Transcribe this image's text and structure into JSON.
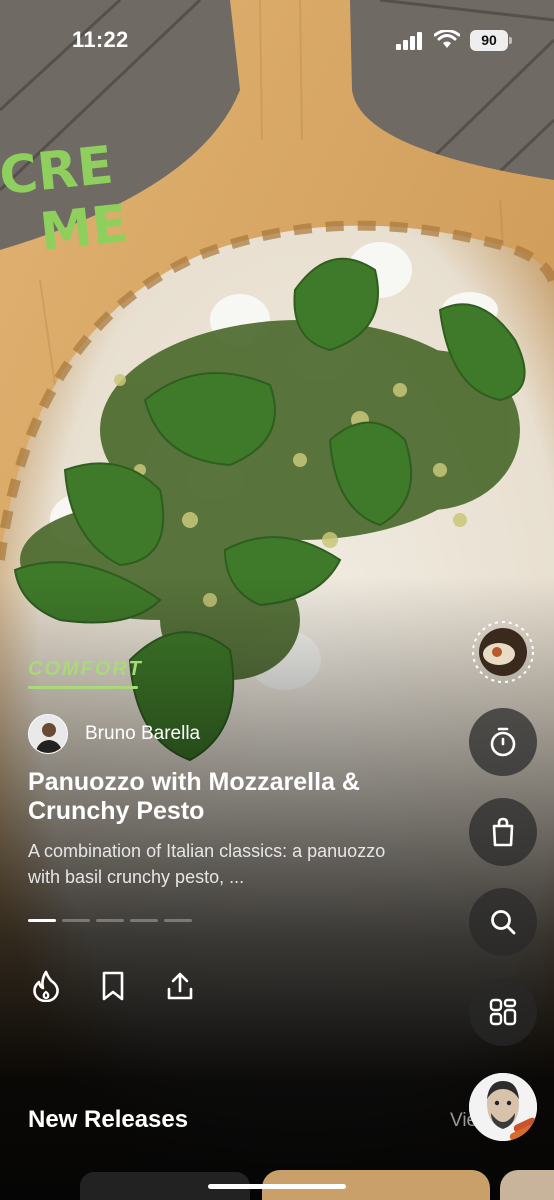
{
  "status_bar": {
    "time": "11:22",
    "battery": "90"
  },
  "brand": {
    "logo_text": "CREME",
    "accent": "#8fcf5d"
  },
  "post": {
    "category": "COMFORT",
    "author": "Bruno Barella",
    "title": "Panuozzo with Mozzarella & Crunchy Pesto",
    "description": "A combination of Italian classics: a panuozzo with basil crunchy pesto, ...",
    "page_count": 5,
    "active_page": 1
  },
  "actions": [
    {
      "icon": "flame-icon"
    },
    {
      "icon": "bookmark-icon"
    },
    {
      "icon": "share-icon"
    }
  ],
  "side_rail": [
    {
      "icon": "recipe-thumbnail"
    },
    {
      "icon": "timer-icon"
    },
    {
      "icon": "shopping-bag-icon"
    },
    {
      "icon": "search-icon"
    },
    {
      "icon": "grid-icon"
    }
  ],
  "section": {
    "title": "New Releases",
    "link": "View all"
  }
}
